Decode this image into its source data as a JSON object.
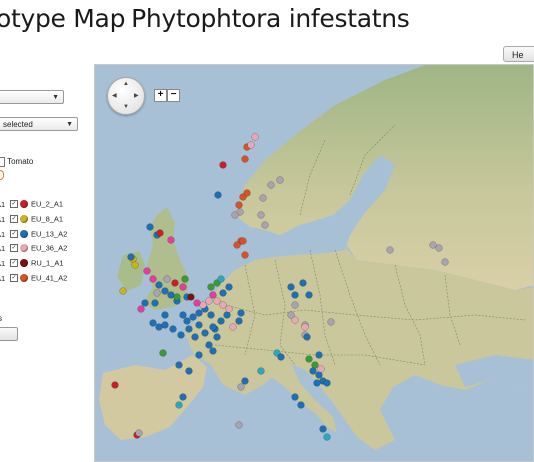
{
  "title": {
    "part1": "otype Map",
    "part2": "Phytophtora infestatns"
  },
  "help_button": {
    "label": "He"
  },
  "filters": {
    "select1": {
      "value": ""
    },
    "select2": {
      "value": "selected"
    }
  },
  "host": {
    "label": "Tomato"
  },
  "legend": {
    "rows": [
      {
        "left": "A1",
        "right": "EU_2_A1",
        "color": "#c8202a"
      },
      {
        "left": "A1",
        "right": "EU_8_A1",
        "color": "#c8b41e"
      },
      {
        "left": "A1",
        "right": "EU_13_A2",
        "color": "#1f6fb4"
      },
      {
        "left": "A1",
        "right": "EU_36_A2",
        "color": "#e6a8b4"
      },
      {
        "left": "A1",
        "right": "RU_1_A1",
        "color": "#7a1414"
      },
      {
        "left": "A1",
        "right": "EU_41_A2",
        "color": "#d4542a"
      }
    ]
  },
  "panel_footer": {
    "label": "s"
  },
  "map": {
    "zoom_in": "+",
    "zoom_out": "−",
    "marker_colors": {
      "EU_2_A1": "#c8202a",
      "EU_8_A1": "#c8b41e",
      "EU_13_A2": "#1f6fb4",
      "EU_36_A2": "#e6a8b4",
      "RU_1_A1": "#7a1414",
      "EU_41_A2": "#d4542a",
      "other_grey": "#a9a2b0",
      "other_pink": "#e0409a",
      "other_green": "#3a9a3a",
      "other_teal": "#2ba8c0"
    }
  }
}
